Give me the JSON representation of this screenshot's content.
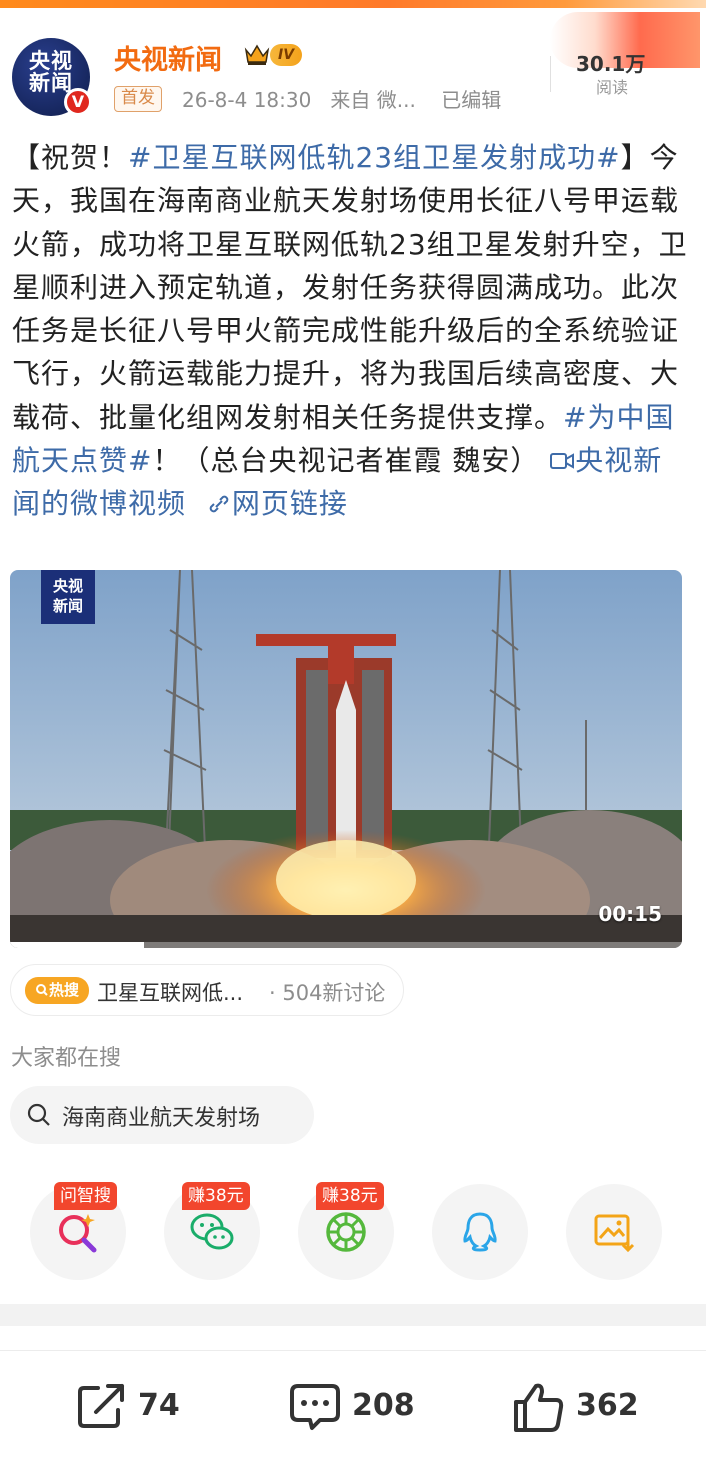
{
  "author": {
    "avatar_text_line1": "央视",
    "avatar_text_line2": "新闻",
    "verified_mark": "V",
    "name": "央视新闻",
    "level": "IV",
    "name_color": "#f26b11"
  },
  "post_meta": {
    "first_tag": "首发",
    "timestamp": "26-8-4 18:30",
    "source_prefix": "来自",
    "source": "微...",
    "edited": "已编辑"
  },
  "reads": {
    "count": "30.1万",
    "label": "阅读"
  },
  "post": {
    "open_bracket": "【祝贺！",
    "hashtag1": "#卫星互联网低轨23组卫星发射成功#",
    "body": "】今天，我国在海南商业航天发射场使用长征八号甲运载火箭，成功将卫星互联网低轨23组卫星发射升空，卫星顺利进入预定轨道，发射任务获得圆满成功。此次任务是长征八号甲火箭完成性能升级后的全系统验证飞行，火箭运载能力提升，将为我国后续高密度、大载荷、批量化组网发射相关任务提供支撑。",
    "hashtag2": "#为中国航天点赞#",
    "closing": "！（总台央视记者崔霞 魏安）",
    "video_link": "央视新闻的微博视频",
    "web_link": "网页链接"
  },
  "video": {
    "logo_line1": "央视",
    "logo_line2": "新闻",
    "duration": "00:15",
    "progress": 0.2
  },
  "hot_search": {
    "badge": "热搜",
    "title": "卫星互联网低...",
    "count": "· 504新讨论"
  },
  "search": {
    "heading": "大家都在搜",
    "query": "海南商业航天发射场"
  },
  "share": {
    "items": [
      {
        "name": "wenzhisou",
        "badge": "问智搜"
      },
      {
        "name": "wechat",
        "badge": "赚38元"
      },
      {
        "name": "moments",
        "badge": "赚38元"
      },
      {
        "name": "qq",
        "badge": ""
      },
      {
        "name": "save-image",
        "badge": ""
      }
    ]
  },
  "actions": {
    "repost": "74",
    "comment": "208",
    "like": "362"
  }
}
